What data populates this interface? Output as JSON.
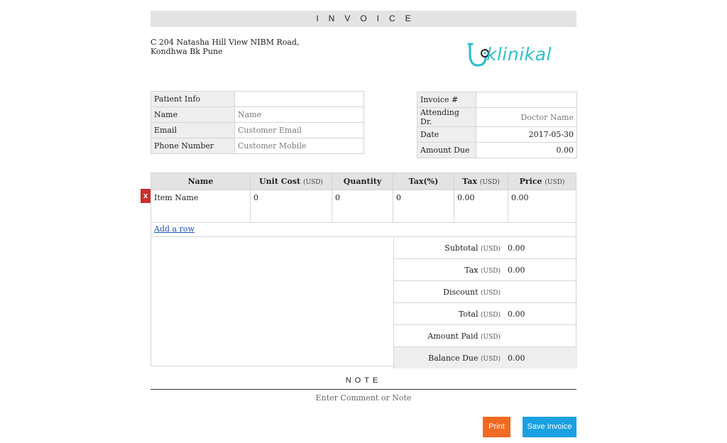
{
  "header": {
    "title": "INVOICE"
  },
  "company": {
    "address_line1": "C 204 Natasha Hill View NIBM Road,",
    "address_line2": "Kondhwa Bk Pune",
    "logo_text": "klinikal",
    "brand_color": "#2fbfcd"
  },
  "patient": {
    "section_label": "Patient Info",
    "name_label": "Name",
    "name_placeholder": "Name",
    "email_label": "Email",
    "email_placeholder": "Customer Email",
    "phone_label": "Phone Number",
    "phone_placeholder": "Customer Mobile"
  },
  "meta": {
    "invoice_label": "Invoice #",
    "invoice_value": "",
    "doctor_label": "Attending Dr.",
    "doctor_placeholder": "Doctor Name",
    "date_label": "Date",
    "date_value": "2017-05-30",
    "amount_due_label": "Amount Due",
    "amount_due_value": "0.00"
  },
  "items": {
    "columns": [
      {
        "label": "Name",
        "unit": ""
      },
      {
        "label": "Unit Cost",
        "unit": "(USD)"
      },
      {
        "label": "Quantity",
        "unit": ""
      },
      {
        "label": "Tax(%)",
        "unit": ""
      },
      {
        "label": "Tax",
        "unit": "(USD)"
      },
      {
        "label": "Price",
        "unit": "(USD)"
      }
    ],
    "rows": [
      {
        "name": "Item Name",
        "unit_cost": "0",
        "quantity": "0",
        "tax_pct": "0",
        "tax": "0.00",
        "price": "0.00"
      }
    ],
    "delete_label": "x",
    "add_row_label": "Add a row"
  },
  "totals": {
    "currency": "(USD)",
    "rows": [
      {
        "label": "Subtotal",
        "value": "0.00"
      },
      {
        "label": "Tax",
        "value": "0.00"
      },
      {
        "label": "Discount",
        "value": ""
      },
      {
        "label": "Total",
        "value": "0.00"
      },
      {
        "label": "Amount Paid",
        "value": ""
      },
      {
        "label": "Balance Due",
        "value": "0.00"
      }
    ]
  },
  "note": {
    "title": "NOTE",
    "placeholder": "Enter Comment or Note"
  },
  "actions": {
    "print_label": "Print",
    "save_label": "Save Invoice",
    "print_color": "#f26a21",
    "save_color": "#1ba0e2"
  }
}
